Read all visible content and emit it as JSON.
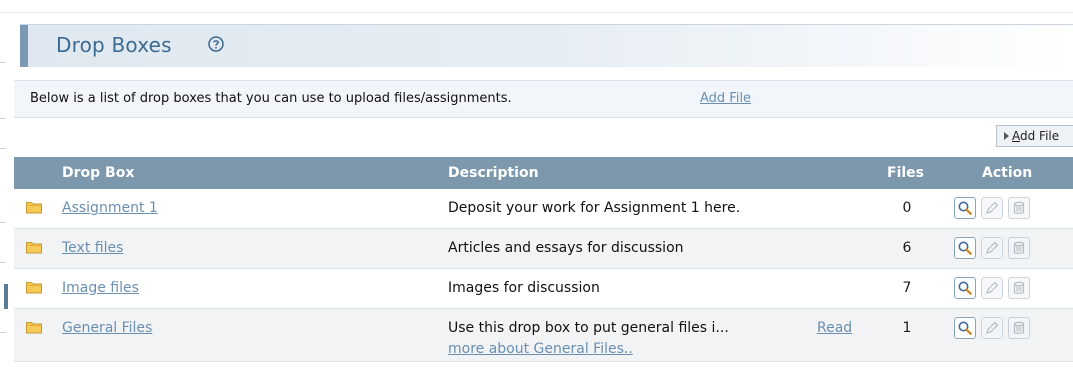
{
  "page": {
    "title": "Drop Boxes",
    "help_icon": "help-circle-icon",
    "intro_text": "Below is a list of drop boxes that you can use to upload files/assignments.",
    "intro_link": "Add File",
    "add_button_label_underlined": "A",
    "add_button_label_rest": "dd File"
  },
  "table": {
    "headers": {
      "name": "Drop Box",
      "description": "Description",
      "files": "Files",
      "action": "Action"
    },
    "rows": [
      {
        "name": "Assignment 1",
        "description": "Deposit your work for Assignment 1 here.",
        "files": "0"
      },
      {
        "name": "Text files",
        "description": "Articles and essays for discussion",
        "files": "6"
      },
      {
        "name": "Image files",
        "description": "Images for discussion",
        "files": "7"
      },
      {
        "name": "General Files",
        "description": "Use this drop box to put general files i...",
        "read": "Read",
        "read_more": "more about General Files..",
        "files": "1"
      }
    ],
    "action_icons": [
      "magnifier-icon",
      "pencil-icon",
      "trash-icon"
    ]
  },
  "colors": {
    "title": "#3d6a90",
    "link": "#6a8fb0",
    "header_bg": "#7d97ad",
    "accent": "#7b99b4"
  }
}
